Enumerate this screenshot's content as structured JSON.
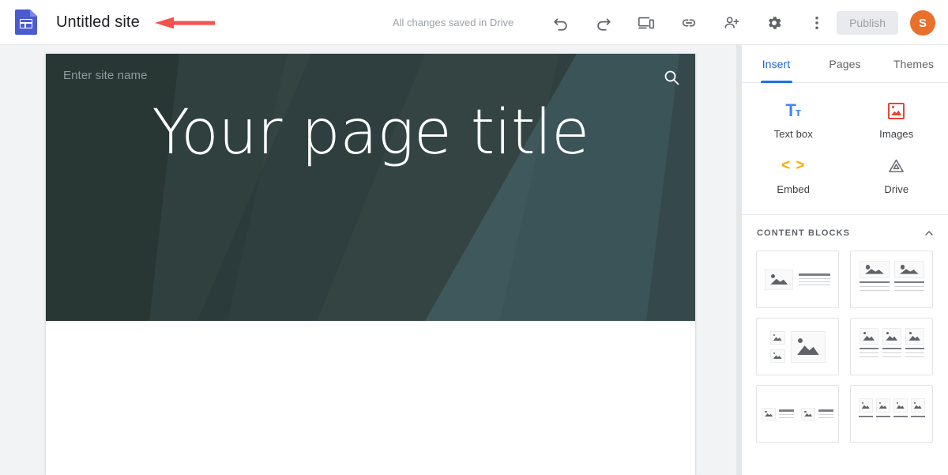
{
  "topbar": {
    "logo_icon": "google-sites-logo",
    "site_title": "Untitled site",
    "save_status": "All changes saved in Drive",
    "tools": [
      {
        "name": "undo-button",
        "icon": "undo-icon"
      },
      {
        "name": "redo-button",
        "icon": "redo-icon"
      },
      {
        "name": "preview-button",
        "icon": "devices-preview-icon"
      },
      {
        "name": "copy-link-button",
        "icon": "link-icon"
      },
      {
        "name": "share-button",
        "icon": "person-add-icon"
      },
      {
        "name": "settings-button",
        "icon": "gear-icon"
      },
      {
        "name": "more-options-button",
        "icon": "more-vert-icon"
      }
    ],
    "publish_label": "Publish",
    "avatar_initial": "S"
  },
  "annotation": {
    "arrow_color": "#f4534d",
    "points_to": "site-title"
  },
  "canvas": {
    "banner": {
      "site_name_placeholder": "Enter site name",
      "search_icon": "search-icon",
      "page_title": "Your page title",
      "background_color": "#30403f",
      "accent_color": "#3b5458"
    }
  },
  "panel": {
    "tabs": [
      {
        "label": "Insert",
        "active": true
      },
      {
        "label": "Pages",
        "active": false
      },
      {
        "label": "Themes",
        "active": false
      }
    ],
    "active_tab_color": "#1a73e8",
    "insert_items": [
      {
        "label": "Text box",
        "icon": "text-box-icon",
        "color": "#4285f4"
      },
      {
        "label": "Images",
        "icon": "images-icon",
        "color": "#ea4335"
      },
      {
        "label": "Embed",
        "icon": "embed-code-icon",
        "color": "#f9ab00"
      },
      {
        "label": "Drive",
        "icon": "google-drive-icon",
        "color": "#5f6368"
      }
    ],
    "content_blocks": {
      "title": "CONTENT BLOCKS",
      "collapse_icon": "chevron-up-icon",
      "layouts": [
        "image-left-text-right",
        "two-images-with-captions",
        "two-small-images-one-large",
        "three-images-with-captions",
        "two-inline-image-text-pairs",
        "four-images-row"
      ]
    }
  }
}
